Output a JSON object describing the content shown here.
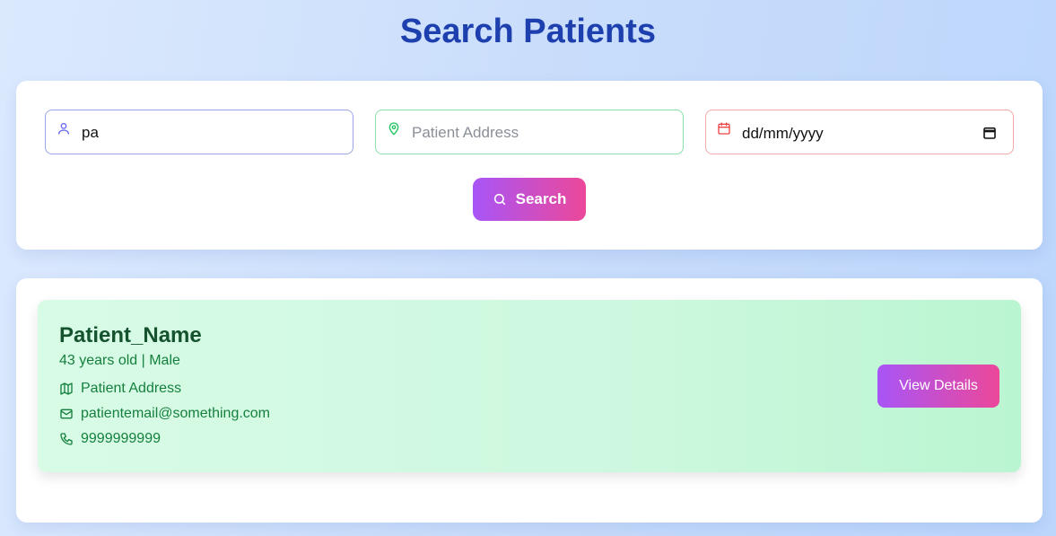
{
  "page": {
    "title": "Search Patients"
  },
  "search": {
    "name_value": "pa",
    "address_placeholder": "Patient Address",
    "date_placeholder": "dd/mm/yyyy",
    "button_label": "Search"
  },
  "results": [
    {
      "name": "Patient_Name",
      "meta": "43 years old | Male",
      "address": "Patient Address",
      "email": "patientemail@something.com",
      "phone": "9999999999",
      "button_label": "View Details"
    }
  ],
  "colors": {
    "title": "#1e40af",
    "accent_gradient": [
      "#a855f7",
      "#ec4899"
    ],
    "card_text": "#15803d",
    "name_icon": "#6366f1",
    "address_icon": "#22c55e",
    "date_icon": "#ef4444"
  },
  "icons": {
    "name_field": "user-icon",
    "address_field": "map-pin-icon",
    "date_field": "calendar-icon",
    "search_button": "search-icon",
    "card_address": "map-icon",
    "card_email": "mail-icon",
    "card_phone": "phone-icon"
  }
}
